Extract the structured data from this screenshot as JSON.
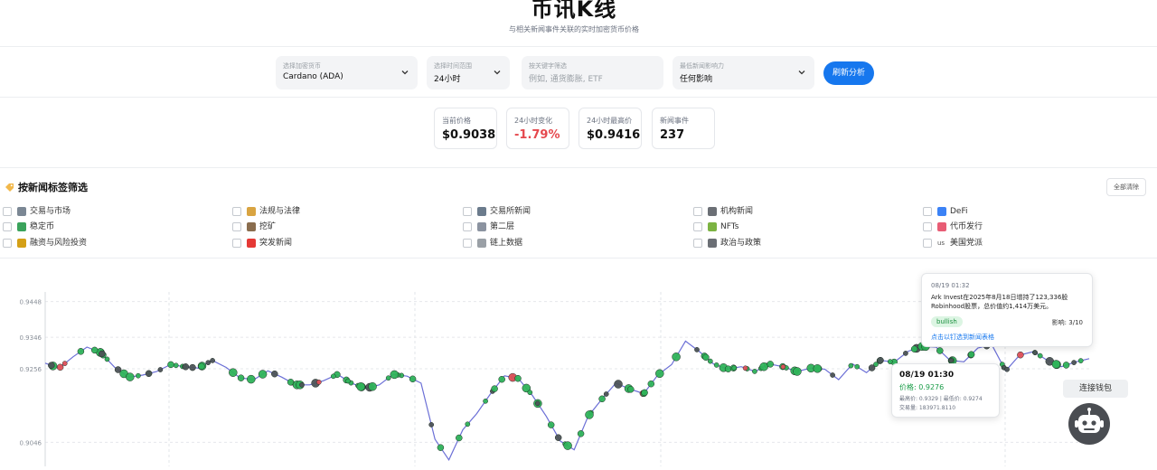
{
  "header": {
    "title": "币讯K线",
    "subtitle": "与相关新闻事件关联的实时加密货币价格"
  },
  "filters": {
    "coin_label": "选择加密货币",
    "coin_value": "Cardano (ADA)",
    "range_label": "选择时间范围",
    "range_value": "24小时",
    "keyword_label": "按关键字筛选",
    "keyword_placeholder": "例如, 通货膨胀, ETF",
    "impact_label": "最低新闻影响力",
    "impact_value": "任何影响",
    "refresh_label": "刷新分析"
  },
  "stats": [
    {
      "label": "当前价格",
      "value": "$0.9038",
      "negative": false
    },
    {
      "label": "24小时变化",
      "value": "-1.79%",
      "negative": true
    },
    {
      "label": "24小时最高价",
      "value": "$0.9416",
      "negative": false
    },
    {
      "label": "新闻事件",
      "value": "237",
      "negative": false
    }
  ],
  "tags": {
    "title": "按新闻标签筛选",
    "clear_label": "全部清除",
    "items": [
      {
        "label": "交易与市场",
        "icon": "chart-icon",
        "color": "#7b8794"
      },
      {
        "label": "法规与法律",
        "icon": "scales-icon",
        "color": "#d9a441"
      },
      {
        "label": "交易所新闻",
        "icon": "exchange-icon",
        "color": "#6b7b8c"
      },
      {
        "label": "机构新闻",
        "icon": "bank-icon",
        "color": "#6b6f75"
      },
      {
        "label": "DeFi",
        "icon": "defi-icon",
        "color": "#3b82f6"
      },
      {
        "label": "稳定币",
        "icon": "money-icon",
        "color": "#3aa35b"
      },
      {
        "label": "挖矿",
        "icon": "pickaxe-icon",
        "color": "#8a6d4e"
      },
      {
        "label": "第二层",
        "icon": "link-icon",
        "color": "#8b93a0"
      },
      {
        "label": "NFTs",
        "icon": "frame-icon",
        "color": "#7cb342"
      },
      {
        "label": "代币发行",
        "icon": "rocket-icon",
        "color": "#e85d75"
      },
      {
        "label": "融资与风险投资",
        "icon": "moneybag-icon",
        "color": "#d4a017"
      },
      {
        "label": "突发新闻",
        "icon": "siren-icon",
        "color": "#e53935"
      },
      {
        "label": "链上数据",
        "icon": "chain-icon",
        "color": "#9aa0a6"
      },
      {
        "label": "政治与政策",
        "icon": "government-icon",
        "color": "#6b6f75"
      },
      {
        "label": "美国党派",
        "icon": "us-flag-icon",
        "prefix": "us",
        "color": "#555555"
      }
    ]
  },
  "chart_data": {
    "type": "line",
    "yticks": [
      "0.9448",
      "0.9346",
      "0.9256",
      "0.9046"
    ],
    "ylim": [
      0.898,
      0.9465
    ],
    "x": [
      0,
      1,
      2,
      3,
      4,
      5,
      6,
      7,
      8,
      9,
      10,
      11,
      12,
      13,
      14,
      15,
      16,
      17,
      18,
      19,
      20,
      21,
      22,
      23,
      24,
      25,
      26,
      27,
      28,
      29,
      30,
      31,
      32,
      33,
      34,
      35,
      36,
      37,
      38,
      39,
      40,
      41,
      42,
      43,
      44,
      45,
      46,
      47,
      48,
      49,
      50,
      51,
      52,
      53,
      54,
      55,
      56,
      57,
      58,
      59,
      60,
      61,
      62,
      63,
      64,
      65,
      66,
      67,
      68,
      69,
      70,
      71,
      72,
      73,
      74,
      75,
      76,
      77,
      78,
      79,
      80,
      81,
      82,
      83,
      84,
      85,
      86,
      87,
      88,
      89,
      90,
      91,
      92,
      93,
      94,
      95,
      96,
      97,
      98,
      99,
      100,
      101,
      102,
      103,
      104,
      105,
      106,
      107,
      108,
      109,
      110,
      111,
      112,
      113,
      114,
      115,
      116,
      117,
      118,
      119
    ],
    "values": [
      0.9272,
      0.9258,
      0.929,
      0.9318,
      0.9302,
      0.926,
      0.9232,
      0.9238,
      0.9248,
      0.9268,
      0.9262,
      0.9258,
      0.928,
      0.926,
      0.923,
      0.9225,
      0.925,
      0.9232,
      0.921,
      0.921,
      0.9222,
      0.924,
      0.9215,
      0.92,
      0.921,
      0.924,
      0.9235,
      0.9215,
      0.9055,
      0.8996,
      0.9082,
      0.9128,
      0.9185,
      0.9236,
      0.9228,
      0.918,
      0.912,
      0.905,
      0.9025,
      0.912,
      0.917,
      0.9215,
      0.9198,
      0.9185,
      0.9238,
      0.9268,
      0.9335,
      0.9305,
      0.927,
      0.9255,
      0.9262,
      0.9248,
      0.927,
      0.9262,
      0.9248,
      0.9258,
      0.9255,
      0.9225,
      0.927,
      0.9245,
      0.928,
      0.9275,
      0.9306,
      0.932,
      0.9318,
      0.928,
      0.9276,
      0.9315,
      0.9325,
      0.925,
      0.9295,
      0.9305,
      0.928,
      0.9262,
      0.9275,
      0.9285
    ],
    "event_colors": [
      "green",
      "red",
      "dark"
    ],
    "tooltip_news": {
      "time": "08/19 01:32",
      "text": "Ark Invest在2025年8月18日增持了123,336股Robinhood股票，总价值约1,414万美元。",
      "sentiment": "bullish",
      "impact": "影响: 3/10",
      "link": "点击以钉选到新闻表格"
    },
    "tooltip_price": {
      "time": "08/19 01:30",
      "price": "价格: 0.9276",
      "high_low": "最高价: 0.9329 | 最低价: 0.9274",
      "volume": "交易量: 183971.8110"
    }
  },
  "widgets": {
    "wallet_label": "连接钱包"
  }
}
